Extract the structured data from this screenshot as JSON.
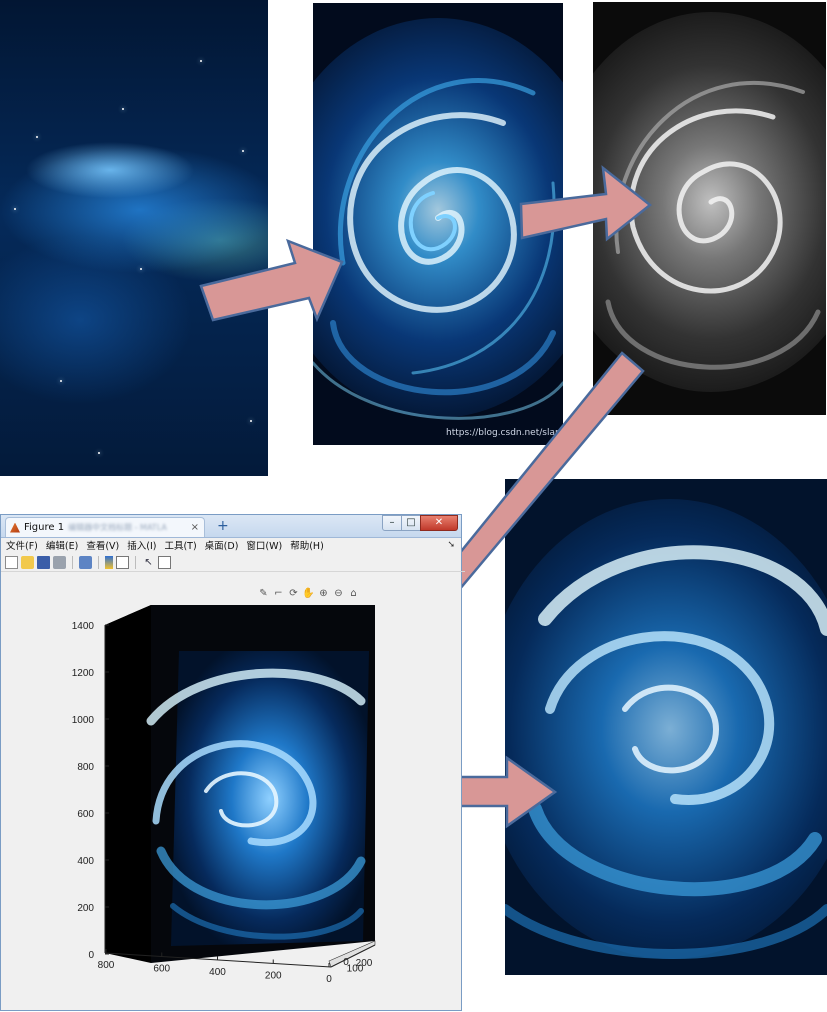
{
  "watermark": "https://blog.csdn.net/slanda",
  "figure": {
    "tab_title": "Figure 1",
    "tab_blurred": "编辑器中文档标题 - MATLA",
    "tab_close": "×",
    "new_tab": "+",
    "window_controls": {
      "minimize": "–",
      "maximize": "□",
      "close": "✕"
    },
    "menu": [
      "文件(F)",
      "编辑(E)",
      "查看(V)",
      "插入(I)",
      "工具(T)",
      "桌面(D)",
      "窗口(W)",
      "帮助(H)"
    ],
    "menu_overflow": "➘",
    "toolbar_icons": [
      "new-file-icon",
      "open-folder-icon",
      "save-icon",
      "print-icon",
      "export-icon",
      "colorbar-icon",
      "legend-icon",
      "pointer-icon",
      "property-inspector-icon"
    ],
    "axes_toolbar_icons": [
      "brush-icon",
      "data-tip-icon",
      "rotate-icon",
      "pan-icon",
      "zoom-in-icon",
      "zoom-out-icon",
      "home-icon"
    ]
  },
  "chart_data": {
    "type": "surface",
    "z_axis_ticks": [
      "0",
      "200",
      "400",
      "600",
      "800",
      "1000",
      "1200",
      "1400"
    ],
    "x_axis_ticks": [
      "800",
      "600",
      "400",
      "200",
      "0"
    ],
    "y_axis_ticks": [
      "0",
      "100",
      "200"
    ],
    "zlim": [
      0,
      1400
    ],
    "xlim": [
      0,
      800
    ],
    "ylim": [
      0,
      200
    ],
    "colormap": "image texture (blue swirl)"
  },
  "colors": {
    "arrow_fill": "#d89796",
    "arrow_stroke": "#4a6a9c",
    "window_border": "#7a9cc4"
  }
}
